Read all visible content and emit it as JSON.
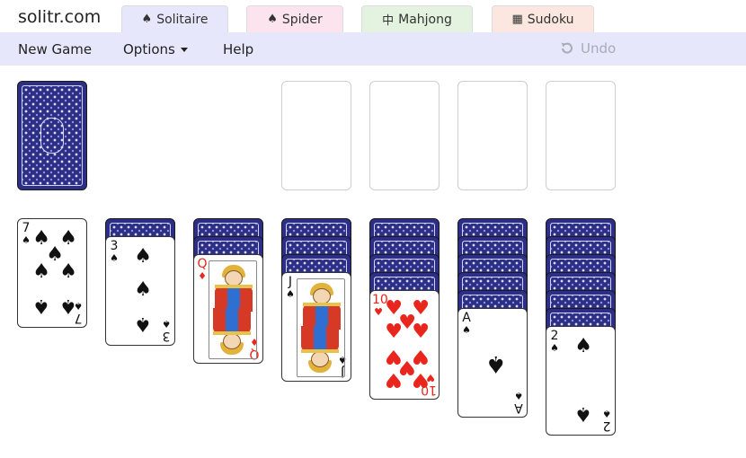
{
  "header": {
    "brand": "solitr.com",
    "tabs": [
      {
        "icon": "♠",
        "label": "Solitaire"
      },
      {
        "icon": "♠",
        "label": "Spider"
      },
      {
        "icon": "中",
        "label": "Mahjong"
      },
      {
        "icon": "▦",
        "label": "Sudoku"
      }
    ]
  },
  "menu": {
    "new_game": "New Game",
    "options": "Options",
    "help": "Help",
    "undo": "Undo"
  },
  "game": {
    "stock": {
      "face_down": 1
    },
    "foundations": 4,
    "tableau": [
      {
        "hidden": 0,
        "top": {
          "rank": "7",
          "suit": "♠",
          "color": "black"
        }
      },
      {
        "hidden": 1,
        "top": {
          "rank": "3",
          "suit": "♠",
          "color": "black"
        }
      },
      {
        "hidden": 2,
        "top": {
          "rank": "Q",
          "suit": "♦",
          "color": "red"
        }
      },
      {
        "hidden": 3,
        "top": {
          "rank": "J",
          "suit": "♠",
          "color": "black"
        }
      },
      {
        "hidden": 4,
        "top": {
          "rank": "10",
          "suit": "♥",
          "color": "red"
        }
      },
      {
        "hidden": 5,
        "top": {
          "rank": "A",
          "suit": "♠",
          "color": "black"
        }
      },
      {
        "hidden": 6,
        "top": {
          "rank": "2",
          "suit": "♠",
          "color": "black"
        }
      }
    ]
  },
  "colors": {
    "tab_active": "#e6e7fb",
    "menubar": "#e6e7fb",
    "card_back": "#2c2f84",
    "red_suit": "#e8261d"
  }
}
